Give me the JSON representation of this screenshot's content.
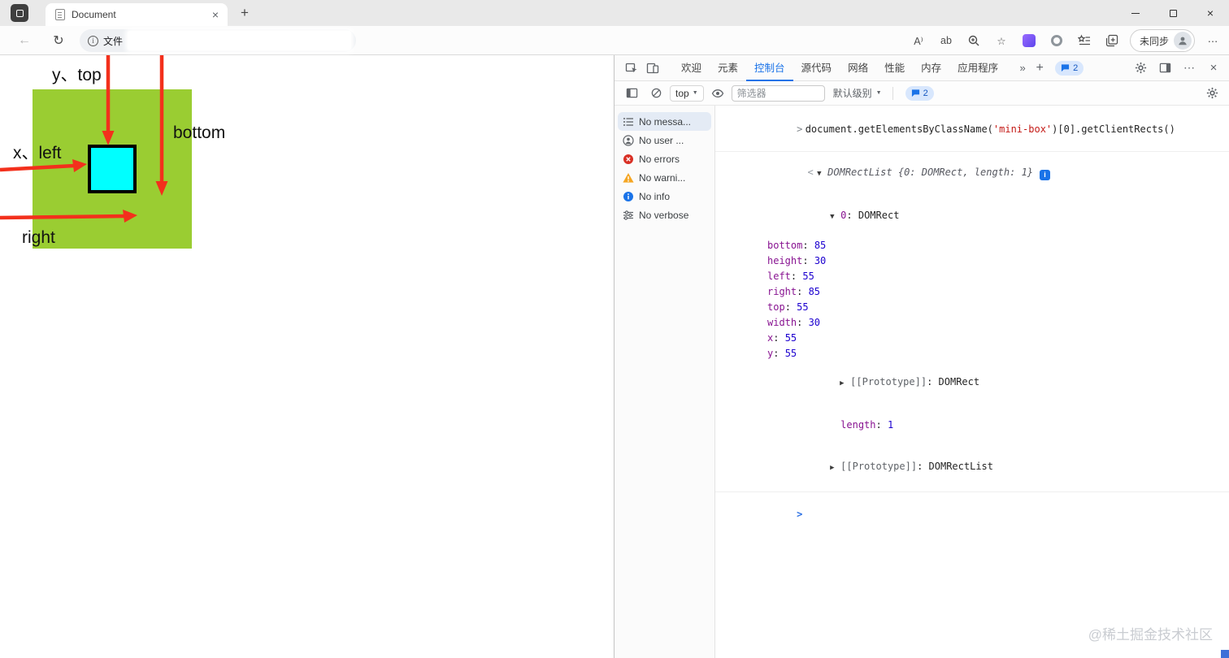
{
  "icons": {
    "back": "←",
    "refresh": "↻",
    "read_aloud": "A⁾",
    "text_tools": "ab",
    "star": "☆",
    "more_horizontal": "⋯",
    "plus": "+",
    "close": "×",
    "overflow_chevron": "»",
    "dropdown_arrow": "▼",
    "command_prompt": ">",
    "result_marker": "<",
    "expand_open": "▼",
    "expand_closed": "▶",
    "info_badge": "i"
  },
  "titlebar": {
    "tab_title": "Document"
  },
  "navbar": {
    "protocol_label": "文件",
    "profile_label": "未同步"
  },
  "page": {
    "labels": {
      "y_top": "y、top",
      "bottom": "bottom",
      "x_left": "x、left",
      "right": "right"
    },
    "colors": {
      "outer_box": "#9ACD32",
      "inner_box": "#00FFFF",
      "inner_border": "#000000",
      "arrow": "#F3301C"
    }
  },
  "devtools": {
    "tabs": [
      "欢迎",
      "元素",
      "控制台",
      "源代码",
      "网络",
      "性能",
      "内存",
      "应用程序"
    ],
    "active_tab": "控制台",
    "issues_count": "2",
    "toolbar": {
      "context": "top",
      "filter_placeholder": "筛选器",
      "levels_label": "默认级别",
      "issues_count": "2"
    },
    "sidebar_items": [
      "No messa...",
      "No user ...",
      "No errors",
      "No warni...",
      "No info",
      "No verbose"
    ],
    "console": {
      "command_prefix": "document.getElementsByClassName(",
      "command_string": "'mini-box'",
      "command_suffix": ")[0].getClientRects()",
      "result_preview": "DOMRectList {0: DOMRect, length: 1}",
      "entry": {
        "key": "0",
        "value": "DOMRect"
      },
      "properties": [
        {
          "name": "bottom",
          "value": "85"
        },
        {
          "name": "height",
          "value": "30"
        },
        {
          "name": "left",
          "value": "55"
        },
        {
          "name": "right",
          "value": "85"
        },
        {
          "name": "top",
          "value": "55"
        },
        {
          "name": "width",
          "value": "30"
        },
        {
          "name": "x",
          "value": "55"
        },
        {
          "name": "y",
          "value": "55"
        }
      ],
      "prototype_rect": {
        "name": "[[Prototype]]",
        "value": "DOMRect"
      },
      "length_prop": {
        "name": "length",
        "value": "1"
      },
      "prototype_list": {
        "name": "[[Prototype]]",
        "value": "DOMRectList"
      }
    },
    "watermark": "@稀土掘金技术社区"
  }
}
